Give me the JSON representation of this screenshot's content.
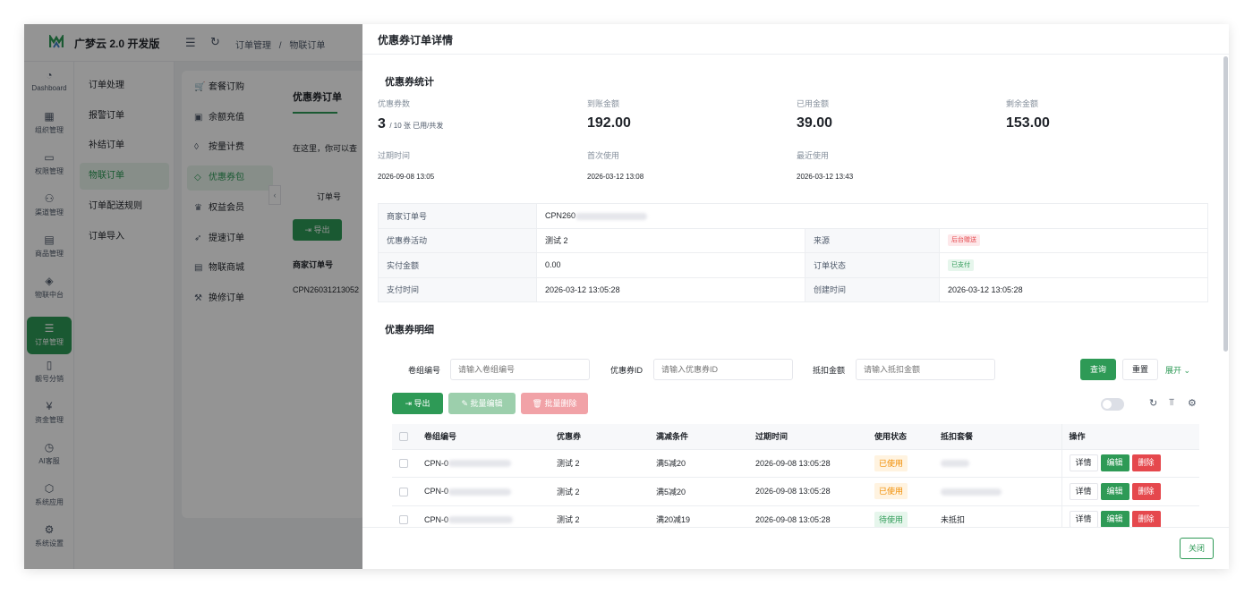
{
  "app": {
    "brand": "广梦云 2.0 开发版",
    "breadcrumbs": [
      "订单管理",
      "/",
      "物联订单"
    ]
  },
  "rail": [
    {
      "label": "Dashboard",
      "icon": "dashboard-icon",
      "glyph": "◔"
    },
    {
      "label": "组织管理",
      "icon": "organization-icon",
      "glyph": "▦"
    },
    {
      "label": "权限管理",
      "icon": "monitor-icon",
      "glyph": "▭"
    },
    {
      "label": "渠道管理",
      "icon": "channel-icon",
      "glyph": "⚇"
    },
    {
      "label": "商品管理",
      "icon": "shop-icon",
      "glyph": "▤"
    },
    {
      "label": "物联中台",
      "icon": "iot-icon",
      "glyph": "◈"
    },
    {
      "label": "订单管理",
      "icon": "order-icon",
      "glyph": "☰"
    },
    {
      "label": "靓号分销",
      "icon": "phone-icon",
      "glyph": "▯"
    },
    {
      "label": "资金管理",
      "icon": "finance-icon",
      "glyph": "¥"
    },
    {
      "label": "AI客服",
      "icon": "ai-service-icon",
      "glyph": "◷"
    },
    {
      "label": "系统应用",
      "icon": "app-icon",
      "glyph": "⬡"
    },
    {
      "label": "系统设置",
      "icon": "settings-icon",
      "glyph": "⚙"
    }
  ],
  "submenu": [
    "订单处理",
    "报警订单",
    "补结订单",
    "物联订单",
    "订单配送规则",
    "订单导入"
  ],
  "categories": [
    {
      "label": "套餐订购",
      "glyph": "🛒"
    },
    {
      "label": "余额充值",
      "glyph": "▣"
    },
    {
      "label": "按量计费",
      "glyph": "◊"
    },
    {
      "label": "优惠券包",
      "glyph": "◇"
    },
    {
      "label": "权益会员",
      "glyph": "♛"
    },
    {
      "label": "提速订单",
      "glyph": "➶"
    },
    {
      "label": "物联商城",
      "glyph": "▤"
    },
    {
      "label": "换修订单",
      "glyph": "⚒"
    }
  ],
  "panel": {
    "title": "优惠券订单",
    "desc": "在这里，你可以查",
    "order_label": "订单号",
    "export": "导出",
    "th": "商家订单号",
    "td": "CPN26031213052"
  },
  "drawer": {
    "title": "优惠券订单详情",
    "stats_title": "优惠券统计",
    "stats": {
      "coupon_count_label": "优惠券数",
      "coupon_used": "3",
      "coupon_total": "/ 10 张 已用/共发",
      "received_label": "到账金额",
      "received": "192.00",
      "used_amount_label": "已用金额",
      "used_amount": "39.00",
      "remaining_label": "剩余金额",
      "remaining": "153.00",
      "expire_label": "过期时间",
      "expire": "2026-09-08 13:05",
      "first_use_label": "首次使用",
      "first_use": "2026-03-12 13:08",
      "last_use_label": "最近使用",
      "last_use": "2026-03-12 13:43"
    },
    "info": {
      "merchant_order_label": "商家订单号",
      "merchant_order": "CPN260",
      "activity_label": "优惠券活动",
      "activity": "测试 2",
      "source_label": "来源",
      "source": "后台赠送",
      "paid_label": "实付金额",
      "paid": "0.00",
      "status_label": "订单状态",
      "status": "已支付",
      "pay_time_label": "支付时间",
      "pay_time": "2026-03-12 13:05:28",
      "create_time_label": "创建时间",
      "create_time": "2026-03-12 13:05:28"
    },
    "detail_title": "优惠券明细",
    "filters": {
      "group_label": "卷组编号",
      "group_placeholder": "请输入卷组编号",
      "coupon_id_label": "优惠券ID",
      "coupon_id_placeholder": "请输入优惠券ID",
      "deduct_label": "抵扣金额",
      "deduct_placeholder": "请输入抵扣金额",
      "query": "查询",
      "reset": "重置",
      "expand": "展开"
    },
    "toolbar": {
      "export": "导出",
      "batch_edit": "批量编辑",
      "batch_delete": "批量删除"
    },
    "table": {
      "headers": [
        "卷组编号",
        "优惠券",
        "满减条件",
        "过期时间",
        "使用状态",
        "抵扣套餐",
        "操作"
      ],
      "rows": [
        {
          "group": "CPN-0",
          "coupon": "测试 2",
          "rule": "满5减20",
          "expire": "2026-09-08 13:05:28",
          "status": "已使用",
          "status_kind": "orange",
          "package": ""
        },
        {
          "group": "CPN-0",
          "coupon": "测试 2",
          "rule": "满5减20",
          "expire": "2026-09-08 13:05:28",
          "status": "已使用",
          "status_kind": "orange",
          "package": ""
        },
        {
          "group": "CPN-0",
          "coupon": "测试 2",
          "rule": "满20减19",
          "expire": "2026-09-08 13:05:28",
          "status": "待使用",
          "status_kind": "teal",
          "package": "未抵扣"
        }
      ],
      "actions": {
        "detail": "详情",
        "edit": "编辑",
        "delete": "删除"
      }
    },
    "close": "关闭"
  },
  "colors": {
    "accent": "#2e9a56",
    "danger": "#e5484d",
    "warning": "#f08c00"
  }
}
